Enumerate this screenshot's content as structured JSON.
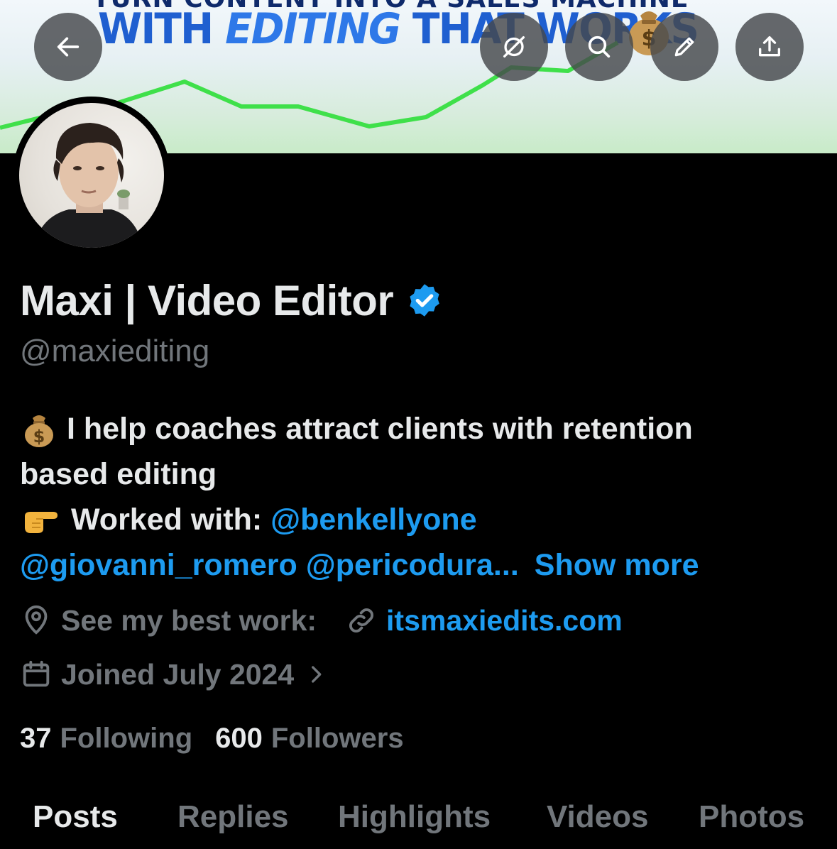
{
  "banner": {
    "top_line": "TURN CONTENT INTO A SALES MACHINE",
    "headline_part1": "WITH ",
    "headline_part2": "EDITING",
    "headline_part3": " THAT WORKS"
  },
  "top_actions": {
    "back": "back-arrow-icon",
    "grok": "grok-icon",
    "search": "search-icon",
    "edit": "pencil-icon",
    "share": "share-icon"
  },
  "profile": {
    "display_name": "Maxi | Video Editor",
    "handle": "@maxiediting",
    "bio": {
      "line1_text": "I help coaches attract clients with retention",
      "line2_text": "based editing",
      "line3_text": " Worked with: ",
      "line3_link": "@benkellyone",
      "line4_link1": "@giovanni_romero",
      "line4_link2": "@pericodura...",
      "show_more": "Show more"
    },
    "location": "See my best work:",
    "website": "itsmaxiedits.com",
    "joined": "Joined July 2024",
    "following_count": "37",
    "following_label": "Following",
    "followers_count": "600",
    "followers_label": "Followers"
  },
  "tabs": [
    "Posts",
    "Replies",
    "Highlights",
    "Videos",
    "Photos"
  ],
  "colors": {
    "background": "#000000",
    "text_primary": "#e7e9ea",
    "text_secondary": "#71767b",
    "link": "#1d9bf0",
    "verified": "#1d9bf0"
  }
}
